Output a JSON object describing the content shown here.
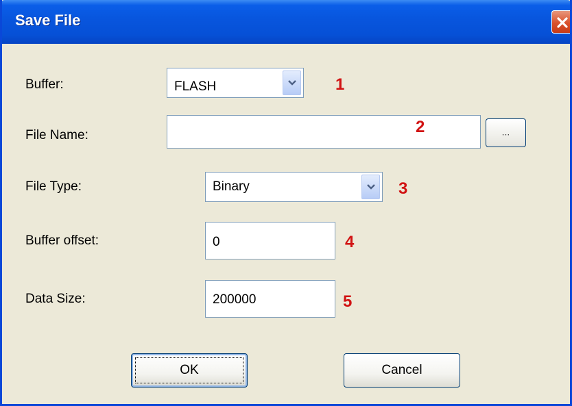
{
  "window": {
    "title": "Save File",
    "close_icon": "close-icon"
  },
  "form": {
    "buffer": {
      "label": "Buffer:",
      "value": "FLASH",
      "annotation": "1"
    },
    "file_name": {
      "label": "File Name:",
      "value": "",
      "annotation": "2",
      "browse_label": "..."
    },
    "file_type": {
      "label": "File Type:",
      "value": "Binary",
      "annotation": "3"
    },
    "buffer_offset": {
      "label": "Buffer offset:",
      "value": "0",
      "annotation": "4"
    },
    "data_size": {
      "label": "Data Size:",
      "value": "200000",
      "annotation": "5"
    }
  },
  "buttons": {
    "ok": "OK",
    "cancel": "Cancel"
  },
  "colors": {
    "annotation": "#D11313",
    "titlebar": "#0855DD",
    "dialog_bg": "#ECE9D8"
  }
}
